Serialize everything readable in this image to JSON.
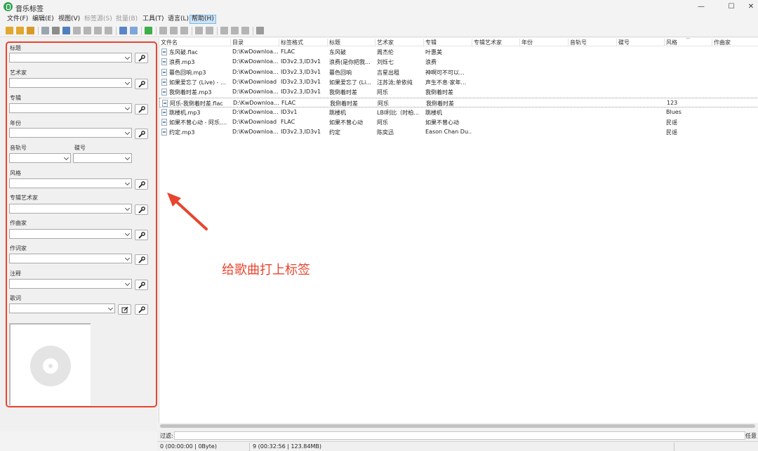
{
  "window": {
    "title": "音乐标签",
    "controls": [
      "—",
      "☐",
      "✕"
    ]
  },
  "menu": [
    {
      "label": "文件(F)",
      "state": "normal"
    },
    {
      "label": "编辑(E)",
      "state": "normal"
    },
    {
      "label": "视图(V)",
      "state": "normal"
    },
    {
      "label": "标签源(S)",
      "state": "disabled"
    },
    {
      "label": "批量(B)",
      "state": "disabled"
    },
    {
      "label": "工具(T)",
      "state": "normal"
    },
    {
      "label": "语言(L)",
      "state": "normal"
    },
    {
      "label": "帮助(H)",
      "state": "active"
    }
  ],
  "toolbar": [
    {
      "icon": "open-folder-icon",
      "color": "#e2a72e"
    },
    {
      "icon": "add-folder-icon",
      "color": "#e2a72e"
    },
    {
      "icon": "folder-files-icon",
      "color": "#d9992a"
    },
    {
      "sep": true
    },
    {
      "icon": "save-icon",
      "color": "#9aa4ae"
    },
    {
      "icon": "remove-icon",
      "color": "#8c8c8c"
    },
    {
      "icon": "undo-icon",
      "color": "#4f7fbf"
    },
    {
      "icon": "tag-window-icon",
      "color": "#b4b4b4"
    },
    {
      "icon": "edit-tag-icon",
      "color": "#b4b4b4"
    },
    {
      "icon": "wrench-dropdown-icon",
      "color": "#b4b4b4"
    },
    {
      "icon": "time-icon",
      "color": "#b4b4b4"
    },
    {
      "sep": true
    },
    {
      "icon": "list-view-icon",
      "color": "#5b86c6"
    },
    {
      "icon": "grid-view-icon",
      "color": "#7fa6d8"
    },
    {
      "sep": true
    },
    {
      "icon": "refresh-icon",
      "color": "#3fae49"
    },
    {
      "sep": true
    },
    {
      "icon": "tag-source-icon",
      "color": "#b4b4b4"
    },
    {
      "icon": "batch-icon",
      "color": "#b4b4b4"
    },
    {
      "icon": "convert-icon",
      "color": "#b4b4b4"
    },
    {
      "sep": true
    },
    {
      "icon": "cut-icon",
      "color": "#b4b4b4"
    },
    {
      "icon": "copy-icon",
      "color": "#b4b4b4"
    },
    {
      "sep": true
    },
    {
      "icon": "rename-icon",
      "color": "#b4b4b4"
    },
    {
      "icon": "organize-icon",
      "color": "#b4b4b4"
    },
    {
      "icon": "image-icon",
      "color": "#b4b4b4"
    },
    {
      "sep": true
    },
    {
      "icon": "settings-icon",
      "color": "#9a9a9a"
    }
  ],
  "fields": {
    "title": "标题",
    "artist": "艺术家",
    "album": "专辑",
    "year": "年份",
    "track": "音轨号",
    "disc": "碟号",
    "genre": "风格",
    "album_artist": "专辑艺术家",
    "composer": "作曲家",
    "lyricist": "作词家",
    "comment": "注释",
    "lyrics": "歌词"
  },
  "columns": [
    "文件名",
    "目录",
    "标签格式",
    "标题",
    "艺术家",
    "专辑",
    "专辑艺术家",
    "年份",
    "音轨号",
    "碟号",
    "风格",
    "作曲家"
  ],
  "files": [
    {
      "name": "东风破.flac",
      "dir": "D:\\KwDownloa...",
      "format": "FLAC",
      "title": "东风破",
      "artist": "周杰伦",
      "album": "叶惠美",
      "genre": ""
    },
    {
      "name": "浪费.mp3",
      "dir": "D:\\KwDownloa...",
      "format": "ID3v2.3,ID3v1",
      "title": "浪费(是你把我...",
      "artist": "刘烁七",
      "album": "浪费",
      "genre": ""
    },
    {
      "name": "暮色回响.mp3",
      "dir": "D:\\KwDownloa...",
      "format": "ID3v2.3,ID3v1",
      "title": "暮色回响",
      "artist": "吉星出租",
      "album": "神啊可不可以...",
      "genre": ""
    },
    {
      "name": "如果爱忘了 (Live) - ...",
      "dir": "D:\\KwDownload",
      "format": "ID3v2.3,ID3v1",
      "title": "如果爱忘了 (Li...",
      "artist": "汪苏泷;单依纯",
      "album": "声生不息·家年...",
      "genre": ""
    },
    {
      "name": "我倒着时差.mp3",
      "dir": "D:\\KwDownloa...",
      "format": "ID3v2.3,ID3v1",
      "title": "我倒着时差",
      "artist": "阿乐",
      "album": "我倒着时差",
      "genre": ""
    },
    {
      "name": "阿乐-我倒着时差.flac",
      "dir": "D:\\KwDownloa...",
      "format": "FLAC",
      "title": "我倒着时差",
      "artist": "阿乐",
      "album": "我倒着时差",
      "genre": "123"
    },
    {
      "name": "跳楼机.mp3",
      "dir": "D:\\KwDownloa...",
      "format": "ID3v1",
      "title": "跳楼机",
      "artist": "LBI利比（时柏...",
      "album": "跳楼机",
      "genre": "Blues"
    },
    {
      "name": "如果不曾心动 - 阿乐....",
      "dir": "D:\\KwDownload",
      "format": "FLAC",
      "title": "如果不曾心动",
      "artist": "阿乐",
      "album": "如果不曾心动",
      "genre": "民谣"
    },
    {
      "name": "约定.mp3",
      "dir": "D:\\KwDownloa...",
      "format": "ID3v2.3,ID3v1",
      "title": "约定",
      "artist": "陈奕迅",
      "album": "Eason Chan Du...",
      "genre": "民谣"
    }
  ],
  "filter": {
    "label": "过滤:",
    "right": "任意"
  },
  "status": {
    "selected": "0 (00:00:00 | 0Byte)",
    "total": "9 (00:32:56 | 123.84MB)"
  },
  "annotation": "给歌曲打上标签",
  "colors": {
    "annotation": "#e8452f",
    "menu_active": "#cce4f7"
  }
}
